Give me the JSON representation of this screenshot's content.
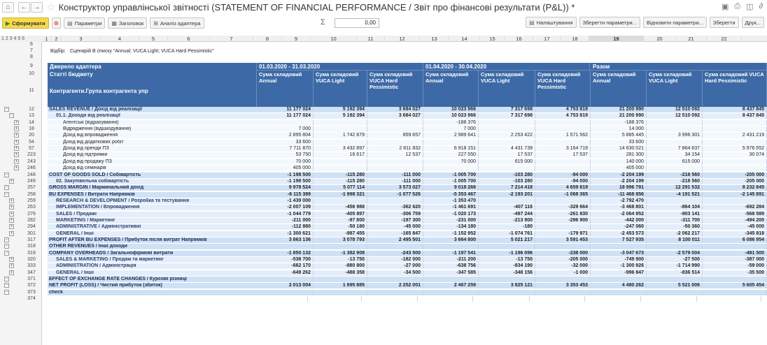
{
  "titlebar": {
    "home_icon": "home-icon",
    "back_icon": "arrow-left-icon",
    "forward_icon": "arrow-right-icon",
    "star_icon": "star-icon",
    "title": "Конструктор управлінської звітності (STATEMENT OF FINANCIAL PERFORMANCE / Звіт про фінансові результати (P&L)) *"
  },
  "toolbar": {
    "run_label": "Сформувати",
    "params_label": "Параметри",
    "header_label": "Заголовок",
    "analysis_label": "Аналіз адаптера",
    "sum_value": "0,00",
    "settings_label": "Налаштування",
    "save_params_label": "Зберегти параметри...",
    "restore_params_label": "Відновити параметри...",
    "save_label": "Зберегти",
    "print_label": "Друк..."
  },
  "columns": {
    "levels": "1 2 3 4 5 6",
    "names": [
      "1",
      "2",
      "3",
      "4",
      "5",
      "6",
      "7",
      "8",
      "9",
      "10",
      "11",
      "12",
      "13",
      "14",
      "15",
      "16",
      "17",
      "18",
      "19",
      "20",
      "21",
      "22"
    ],
    "selected": "19"
  },
  "filter": {
    "label": "Відбір:",
    "text": "Сценарій В списку \"Annual; VUCA Light; VUCA Hard Pessimistic\""
  },
  "header": {
    "source": "Джерело адаптера",
    "items": "Статті бюджету",
    "counterparty": "Контрагенти.Група контрагента упр",
    "periods": [
      "01.03.2020 - 31.03.2020",
      "01.04.2020 - 30.04.2020",
      "Разом"
    ],
    "measures": [
      "Сума складовий Annual",
      "Сума складовий VUCA Light",
      "Сума складовий VUCA Hard Pessimistic"
    ]
  },
  "rows": [
    {
      "n": "12",
      "label": "SALES REVENUE / Дохід від реалізації",
      "style": "g1",
      "v": [
        "11 177 024",
        "5 192 394",
        "3 684 027",
        "10 023 966",
        "7 317 698",
        "4 753 819",
        "21 200 990",
        "12 510 092",
        "8 437 845"
      ]
    },
    {
      "n": "13",
      "label": "01.1. Доходи від реалізації",
      "style": "g2",
      "v": [
        "11 177 024",
        "5 192 394",
        "3 684 027",
        "10 023 966",
        "7 317 698",
        "4 753 819",
        "21 200 990",
        "12 510 092",
        "8 437 845"
      ]
    },
    {
      "n": "14",
      "label": "Агентські (відрахування)",
      "style": "d",
      "v": [
        "",
        "",
        "",
        "-188 376",
        "",
        "",
        "-188 376",
        "",
        ""
      ]
    },
    {
      "n": "18",
      "label": "Відрядження (відшкодування)",
      "style": "d",
      "v": [
        "7 000",
        "",
        "",
        "7 000",
        "",
        "",
        "14 000",
        "",
        ""
      ]
    },
    {
      "n": "20",
      "label": "Дохід від впровадження",
      "style": "d",
      "v": [
        "2 895 804",
        "1 742 879",
        "859 657",
        "2 989 641",
        "2 253 422",
        "1 571 562",
        "5 885 445",
        "3 996 301",
        "2 431 219"
      ]
    },
    {
      "n": "54",
      "label": "Дохід від додаткових робіт",
      "style": "d",
      "v": [
        "33 600",
        "",
        "",
        "",
        "",
        "",
        "33 600",
        "",
        ""
      ]
    },
    {
      "n": "57",
      "label": "Дохід від оренди ПЗ",
      "style": "d",
      "v": [
        "7 711 870",
        "3 432 897",
        "2 811 832",
        "6 918 151",
        "4 431 739",
        "3 164 719",
        "14 630 021",
        "7 864 637",
        "5 976 552"
      ]
    },
    {
      "n": "223",
      "label": "Дохід від підтримки",
      "style": "d",
      "v": [
        "53 750",
        "16 617",
        "12 537",
        "227 550",
        "17 537",
        "17 537",
        "281 300",
        "34 154",
        "30 074"
      ]
    },
    {
      "n": "243",
      "label": "Дохід від продажу ПЗ",
      "style": "d",
      "v": [
        "70 000",
        "",
        "",
        "70 000",
        "615 000",
        "",
        "140 000",
        "615 000",
        ""
      ]
    },
    {
      "n": "246",
      "label": "Дохід від семінарів",
      "style": "d",
      "v": [
        "405 000",
        "",
        "",
        "",
        "",
        "",
        "405 000",
        "",
        ""
      ]
    },
    {
      "n": "248",
      "label": "COST OF GOODS SOLD / Собівартість",
      "style": "g1",
      "v": [
        "-1 198 500",
        "-115 280",
        "-111 000",
        "-1 005 700",
        "-103 280",
        "-94 000",
        "-2 204 199",
        "-218 560",
        "-205 000"
      ]
    },
    {
      "n": "249",
      "label": "02. Закупівельна собівартість",
      "style": "g2",
      "v": [
        "-1 198 500",
        "-115 280",
        "-111 000",
        "-1 005 700",
        "-103 280",
        "-94 000",
        "-2 204 199",
        "-218 560",
        "-205 000"
      ]
    },
    {
      "n": "257",
      "label": "GROSS MARGIN / Маржинальний дохід",
      "style": "g1",
      "v": [
        "9 978 524",
        "5 077 114",
        "3 573 027",
        "9 018 266",
        "7 214 418",
        "4 659 819",
        "18 996 791",
        "12 291 532",
        "8 232 845"
      ]
    },
    {
      "n": "258",
      "label": "BU EXPENSES / Витрати Напрямків",
      "style": "g1",
      "v": [
        "-6 115 389",
        "-1 998 321",
        "-1 077 526",
        "-5 353 467",
        "-2 193 201",
        "-1 068 365",
        "-11 468 856",
        "-4 191 521",
        "-2 145 891"
      ]
    },
    {
      "n": "259",
      "label": "RESEARCH & DEVELOPMENT / Розробка та тестування",
      "style": "g2",
      "v": [
        "-1 439 000",
        "",
        "",
        "-1 353 470",
        "",
        "",
        "-2 792 470",
        "",
        ""
      ]
    },
    {
      "n": "263",
      "label": "IMPLEMENTATION / Впровадження",
      "style": "g2",
      "v": [
        "-2 007 109",
        "-456 988",
        "-362 620",
        "-1 461 691",
        "-407 116",
        "-329 664",
        "-3 468 801",
        "-864 104",
        "-692 284"
      ]
    },
    {
      "n": "276",
      "label": "SALES / Продажі",
      "style": "g2",
      "v": [
        "-1 044 779",
        "-405 897",
        "-306 759",
        "-1 020 173",
        "-497 244",
        "-261 830",
        "-2 064 952",
        "-903 141",
        "-568 589"
      ]
    },
    {
      "n": "282",
      "label": "MARKETING / Маркетинг",
      "style": "g2",
      "v": [
        "-211 000",
        "-97 800",
        "-197 300",
        "-231 000",
        "-213 900",
        "-296 900",
        "-442 000",
        "-311 700",
        "-494 200"
      ]
    },
    {
      "n": "294",
      "label": "ADMINISTRATIVE / Адміністративні",
      "style": "g2",
      "v": [
        "-112 880",
        "-50 180",
        "-45 000",
        "-134 180",
        "-180",
        "",
        "-247 060",
        "-50 360",
        "-45 000"
      ]
    },
    {
      "n": "301",
      "label": "GENERAL / Інші",
      "style": "g2",
      "v": [
        "-1 300 621",
        "-987 455",
        "-165 847",
        "-1 152 952",
        "-1 074 761",
        "-179 971",
        "-2 453 573",
        "-2 062 217",
        "-345 818"
      ]
    },
    {
      "n": "317",
      "label": "PROFIT AFTER BU EXPENSES / Прибуток після витрат Напрямків",
      "style": "g1",
      "v": [
        "3 863 136",
        "3 078 793",
        "2 495 501",
        "3 664 800",
        "5 021 217",
        "3 591 453",
        "7 527 935",
        "8 100 011",
        "6 086 954"
      ]
    },
    {
      "n": "318",
      "label": "OTHER REVENUES / Інші доходи",
      "style": "g1",
      "v": [
        "",
        "",
        "",
        "",
        "",
        "",
        "",
        "",
        ""
      ]
    },
    {
      "n": "319",
      "label": "COMPANY OVERHEADS / Загальнофірмові витрати",
      "style": "g1",
      "v": [
        "-1 850 132",
        "-1 382 908",
        "-243 500",
        "-1 197 541",
        "-1 196 096",
        "-238 000",
        "-3 047 673",
        "-2 579 004",
        "-481 500"
      ]
    },
    {
      "n": "320",
      "label": "SALES & MARKETING / Продаж та маркетинг",
      "style": "g2",
      "v": [
        "-538 700",
        "-13 750",
        "-182 000",
        "-211 200",
        "-13 750",
        "-205 000",
        "-749 900",
        "-27 500",
        "-387 000"
      ]
    },
    {
      "n": "333",
      "label": "ADMINISTRATION / Адміністрація",
      "style": "g2",
      "v": [
        "-662 170",
        "-880 800",
        "-27 000",
        "-638 756",
        "-834 190",
        "-32 000",
        "-1 300 926",
        "-1 714 990",
        "-59 000"
      ]
    },
    {
      "n": "347",
      "label": "GENERAL / Інші",
      "style": "g2",
      "v": [
        "-649 262",
        "-488 358",
        "-34 500",
        "-347 585",
        "-348 156",
        "-1 000",
        "-996 847",
        "-836 514",
        "-35 500"
      ]
    },
    {
      "n": "371",
      "label": "EFFECT OF EXCHANGE RATE CHANGES / Курсові різниці",
      "style": "g1",
      "v": [
        "",
        "",
        "",
        "",
        "",
        "",
        "",
        "",
        ""
      ]
    },
    {
      "n": "372",
      "label": "NET PROFIT (LOSS) / Чистий прибуток (збиток)",
      "style": "g1",
      "v": [
        "2 013 004",
        "1 695 885",
        "2 252 001",
        "2 467 259",
        "3 825 121",
        "3 353 453",
        "4 480 262",
        "5 521 006",
        "5 605 454"
      ]
    },
    {
      "n": "373",
      "label": "check",
      "style": "g1",
      "v": [
        "",
        "",
        "",
        "",
        "",
        "",
        "",
        "",
        ""
      ]
    },
    {
      "n": "374",
      "label": "",
      "style": "e",
      "v": [
        "",
        "",
        "",
        "",
        "",
        "",
        "",
        "",
        ""
      ]
    }
  ],
  "colors": {
    "header_bg": "#3d6aa6",
    "group1_bg": "#cfe1f5",
    "group2_bg": "#e4eefa",
    "detail_bg": "#f3f8fd",
    "accent": "#f7d94c"
  }
}
